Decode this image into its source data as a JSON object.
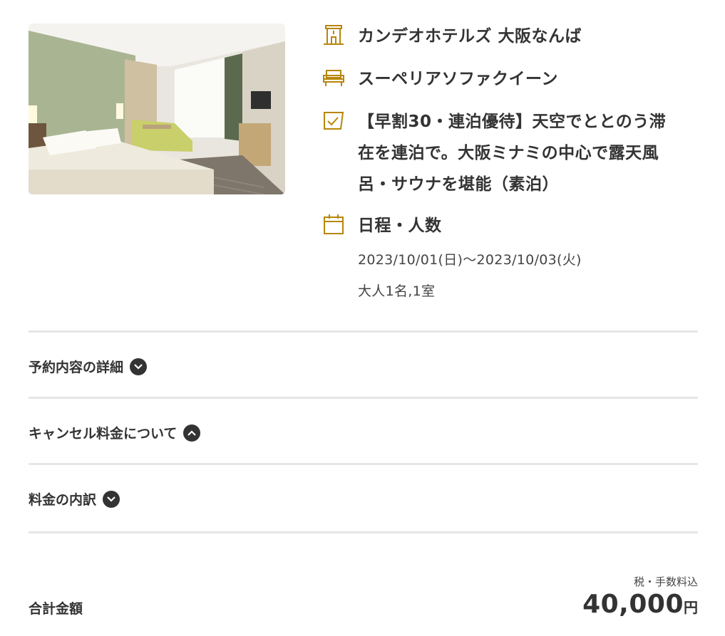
{
  "hotel": {
    "name": "カンデオホテルズ 大阪なんば",
    "room_type": "スーペリアソファクイーン",
    "plan_lines": [
      "【早割30・連泊優待】天空でととのう滞",
      "在を連泊で。大阪ミナミの中心で露天風",
      "呂・サウナを堪能（素泊）"
    ]
  },
  "schedule": {
    "heading": "日程・人数",
    "dates": "2023/10/01(日)～2023/10/03(火)",
    "guests": "大人1名,1室"
  },
  "sections": [
    {
      "label": "予約内容の詳細",
      "state": "collapsed"
    },
    {
      "label": "キャンセル料金について",
      "state": "expanded"
    },
    {
      "label": "料金の内訳",
      "state": "collapsed"
    }
  ],
  "total": {
    "label": "合計金額",
    "tax_note": "税・手数料込",
    "amount": "40,000",
    "currency": "円"
  },
  "icons": {
    "hotel": "building-icon",
    "room": "sofa-icon",
    "plan": "plan-check-icon",
    "schedule": "calendar-icon"
  },
  "colors": {
    "accent": "#b8860b",
    "text": "#333333",
    "divider": "#e6e6e6"
  }
}
